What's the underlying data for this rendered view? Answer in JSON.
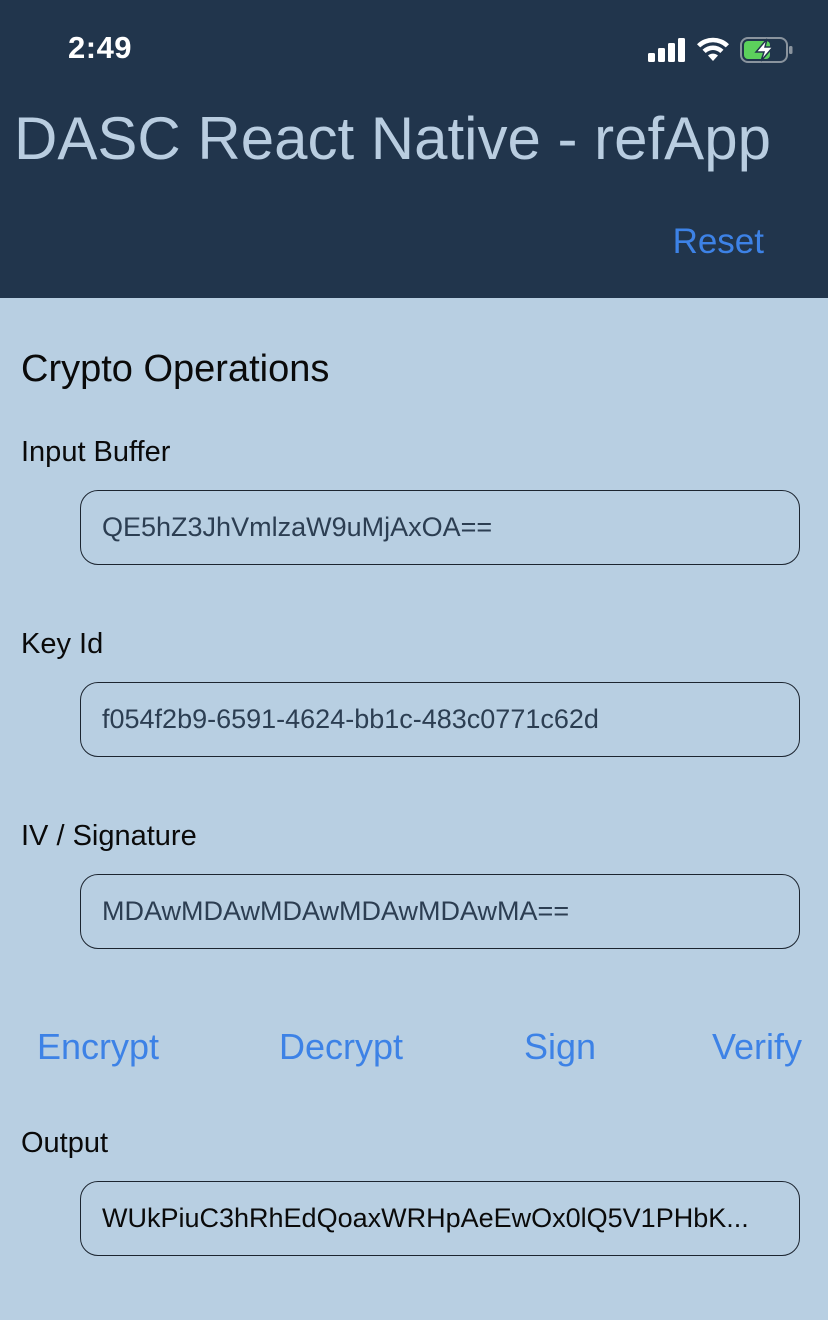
{
  "status_bar": {
    "time": "2:49",
    "icons": [
      "cellular-signal-icon",
      "wifi-icon",
      "battery-charging-icon"
    ]
  },
  "header": {
    "title": "DASC React Native - refApp",
    "reset_label": "Reset"
  },
  "section": {
    "title": "Crypto Operations"
  },
  "fields": {
    "input_buffer": {
      "label": "Input Buffer",
      "value": "QE5hZ3JhVmlzaW9uMjAxOA=="
    },
    "key_id": {
      "label": "Key Id",
      "value": "f054f2b9-6591-4624-bb1c-483c0771c62d"
    },
    "iv_signature": {
      "label": "IV / Signature",
      "value": "MDAwMDAwMDAwMDAwMDAwMA=="
    },
    "output": {
      "label": "Output",
      "value": "WUkPiuC3hRhEdQoaxWRHpAeEwOx0lQ5V1PHbK..."
    }
  },
  "actions": {
    "encrypt": "Encrypt",
    "decrypt": "Decrypt",
    "sign": "Sign",
    "verify": "Verify"
  },
  "colors": {
    "header_bg": "#21354c",
    "body_bg": "#b8cfe2",
    "accent": "#3d82e6",
    "title_text": "#b9cde0"
  }
}
